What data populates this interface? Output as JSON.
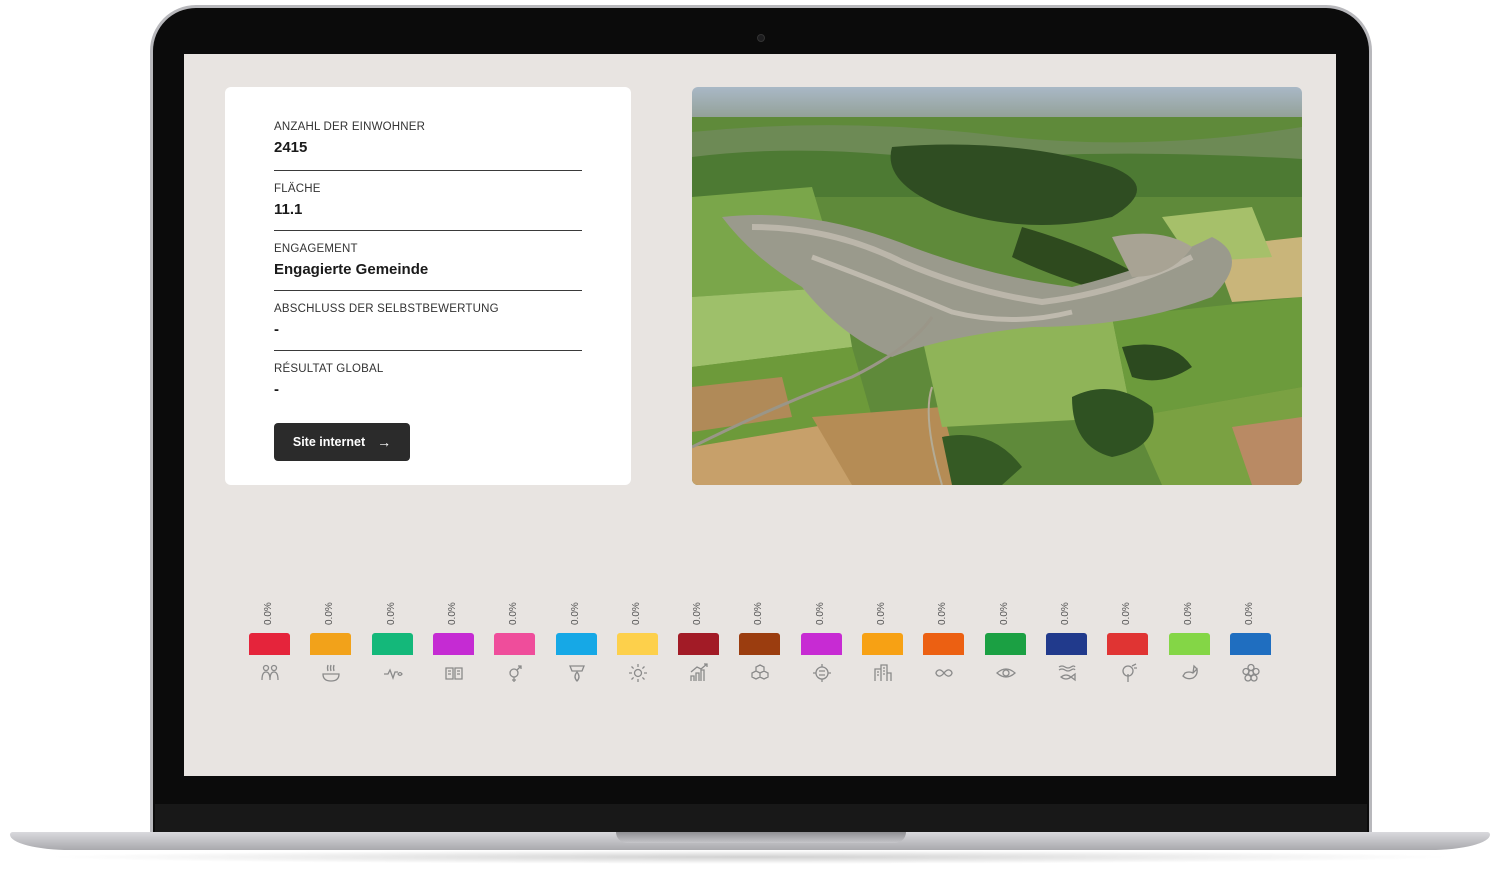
{
  "profile": {
    "population_label": "ANZAHL DER EINWOHNER",
    "population_value": "2415",
    "area_label": "FLÄCHE",
    "area_value": "11.1",
    "engagement_label": "ENGAGEMENT",
    "engagement_value": "Engagierte Gemeinde",
    "selfassessment_label": "ABSCHLUSS DER SELBSTBEWERTUNG",
    "selfassessment_value": "-",
    "global_result_label": "RÉSULTAT GLOBAL",
    "global_result_value": "-",
    "website_button_label": "Site internet",
    "website_button_arrow": "→"
  },
  "goals": [
    {
      "pct": "0.0%",
      "color": "#e5243b",
      "icon": "people-icon"
    },
    {
      "pct": "0.0%",
      "color": "#f2a21a",
      "icon": "bowl-icon"
    },
    {
      "pct": "0.0%",
      "color": "#14b87a",
      "icon": "heartbeat-icon"
    },
    {
      "pct": "0.0%",
      "color": "#c52bd3",
      "icon": "book-icon"
    },
    {
      "pct": "0.0%",
      "color": "#ef4d9b",
      "icon": "gender-icon"
    },
    {
      "pct": "0.0%",
      "color": "#16a8e6",
      "icon": "water-drop-icon"
    },
    {
      "pct": "0.0%",
      "color": "#fdd04b",
      "icon": "sun-icon"
    },
    {
      "pct": "0.0%",
      "color": "#a21b26",
      "icon": "growth-chart-icon"
    },
    {
      "pct": "0.0%",
      "color": "#9b3d0f",
      "icon": "cubes-icon"
    },
    {
      "pct": "0.0%",
      "color": "#c72bd3",
      "icon": "equality-icon"
    },
    {
      "pct": "0.0%",
      "color": "#f7a114",
      "icon": "city-icon"
    },
    {
      "pct": "0.0%",
      "color": "#ec6012",
      "icon": "infinity-icon"
    },
    {
      "pct": "0.0%",
      "color": "#1ba043",
      "icon": "eye-icon"
    },
    {
      "pct": "0.0%",
      "color": "#213a8c",
      "icon": "fish-waves-icon"
    },
    {
      "pct": "0.0%",
      "color": "#e03433",
      "icon": "tree-icon"
    },
    {
      "pct": "0.0%",
      "color": "#84d646",
      "icon": "dove-icon"
    },
    {
      "pct": "0.0%",
      "color": "#1f6ec0",
      "icon": "flower-icon"
    }
  ]
}
